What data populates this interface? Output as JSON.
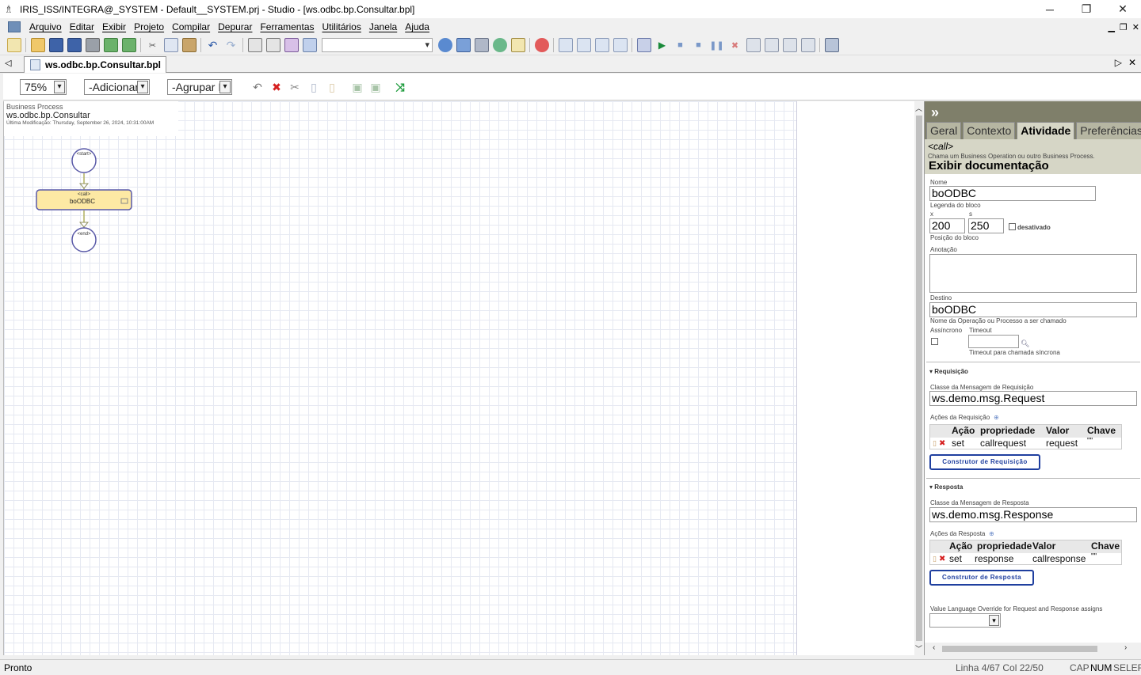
{
  "window": {
    "title": "IRIS_ISS/INTEGRA@_SYSTEM - Default__SYSTEM.prj - Studio - [ws.odbc.bp.Consultar.bpl]",
    "minimize": "─",
    "maximize": "❐",
    "close": "✕"
  },
  "menu": {
    "items": [
      "Arquivo",
      "Editar",
      "Exibir",
      "Projeto",
      "Compilar",
      "Depurar",
      "Ferramentas",
      "Utilitários",
      "Janela",
      "Ajuda"
    ],
    "mdi_minimize": "▁",
    "mdi_restore": "❐",
    "mdi_close": "✕"
  },
  "doc_tab": {
    "label": "ws.odbc.bp.Consultar.bpl",
    "left_arrow": "◁",
    "right_arrow": "▷",
    "close": "✕"
  },
  "editor_toolbar": {
    "zoom": "75%",
    "add": "-Adicionar",
    "group": "-Agrupar It"
  },
  "canvas": {
    "kind": "Business Process",
    "name": "ws.odbc.bp.Consultar",
    "modified": "Última Modificação: Thursday, September 26, 2024, 10:31:00AM",
    "start_label": "<start>",
    "call_type": "<call>",
    "call_name": "boODBC",
    "end_label": "<end>"
  },
  "inspector": {
    "collapse": "»",
    "tabs": [
      "Geral",
      "Contexto",
      "Atividade",
      "Preferências"
    ],
    "active_tab": "Atividade",
    "element_type": "<call>",
    "element_desc": "Chama um Business Operation ou outro Business Process.",
    "doc_link": "Exibir documentação",
    "name_label": "Nome",
    "name_value": "boODBC",
    "name_hint": "Legenda do bloco",
    "x_label": "x",
    "y_label": "s",
    "x_value": "200",
    "y_value": "250",
    "disabled_label": "desativado",
    "pos_hint": "Posição do bloco",
    "annotation_label": "Anotação",
    "target_label": "Destino",
    "target_value": "boODBC",
    "target_hint": "Nome da Operação ou Processo a ser chamado",
    "async_label": "Assíncrono",
    "timeout_label": "Timeout",
    "timeout_hint": "Timeout para chamada síncrona",
    "request": {
      "section": "Requisição",
      "class_label": "Classe da Mensagem de Requisição",
      "class_value": "ws.demo.msg.Request",
      "actions_label": "Ações da Requisição",
      "headers": [
        "Ação",
        "propriedade",
        "Valor",
        "Chave"
      ],
      "row": [
        "set",
        "callrequest",
        "request",
        "\"\""
      ],
      "builder_button": "Construtor de Requisição"
    },
    "response": {
      "section": "Resposta",
      "class_label": "Classe da Mensagem de Resposta",
      "class_value": "ws.demo.msg.Response",
      "actions_label": "Ações da Resposta",
      "headers": [
        "Ação",
        "propriedade",
        "Valor",
        "Chave"
      ],
      "row": [
        "set",
        "response",
        "callresponse",
        "\"\""
      ],
      "builder_button": "Construtor de Resposta"
    },
    "override_label": "Value Language Override for Request and Response assigns"
  },
  "status": {
    "ready": "Pronto",
    "position": "Linha 4/67 Col 22/50",
    "cap": "CAP",
    "num": "NUM",
    "se": "SE",
    "ler": "LER"
  },
  "colors": {
    "inspector_header": "#7f7f6a",
    "inspector_bg": "#d6d6c6",
    "call_fill": "#fde9a4",
    "shape_stroke": "#5a5aa8",
    "button_text": "#1f3f9f"
  }
}
